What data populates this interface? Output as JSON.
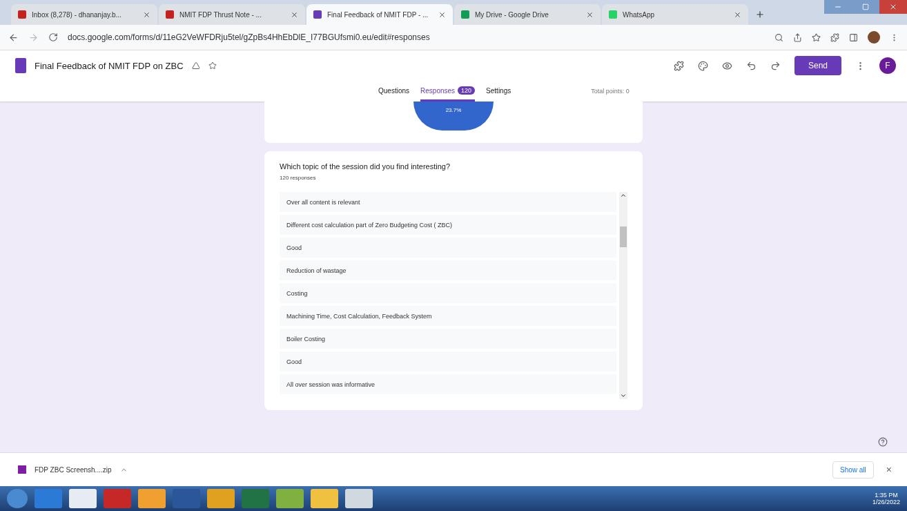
{
  "browser_tabs": [
    {
      "title": "Inbox (8,278) - dhananjay.b...",
      "selected": false,
      "color": "#c5221f"
    },
    {
      "title": "NMIT FDP Thrust Note - ...",
      "selected": false,
      "color": "#c5221f"
    },
    {
      "title": "Final Feedback of NMIT FDP - ...",
      "selected": true,
      "color": "#673ab7"
    },
    {
      "title": "My Drive - Google Drive",
      "selected": false,
      "color": "#0f9d58"
    },
    {
      "title": "WhatsApp",
      "selected": false,
      "color": "#25d366"
    }
  ],
  "address_bar": {
    "url": "docs.google.com/forms/d/11eG2VeWFDRju5tel/gZpBs4HhEbDlE_I77BGUfsmi0.eu/edit#responses"
  },
  "form_header": {
    "title": "Final Feedback of NMIT FDP on ZBC",
    "send_button": "Send",
    "avatar": "F",
    "tabs": [
      {
        "label": "Questions",
        "selected": false
      },
      {
        "label": "Responses",
        "badge": "120",
        "selected": true
      },
      {
        "label": "Settings",
        "selected": false
      }
    ],
    "total_points": "Total points: 0"
  },
  "pie_card": {
    "slice_label": "23.7%"
  },
  "question_card": {
    "question": "Which topic of the session did you find interesting?",
    "count": "120 responses",
    "responses": [
      "Over all content is relevant",
      "Different cost calculation part of Zero Budgeting Cost ( ZBC)",
      "Good",
      "Reduction of wastage",
      "Costing",
      "Machining Time, Cost Calculation, Feedback System",
      "Boiler Costing",
      "Good",
      "All over session was informative"
    ]
  },
  "download_bar": {
    "file": "FDP ZBC Screensh....zip",
    "show_all": "Show all",
    "close": "×"
  },
  "taskbar": {
    "time": "1:35 PM",
    "date": "1/26/2022"
  }
}
